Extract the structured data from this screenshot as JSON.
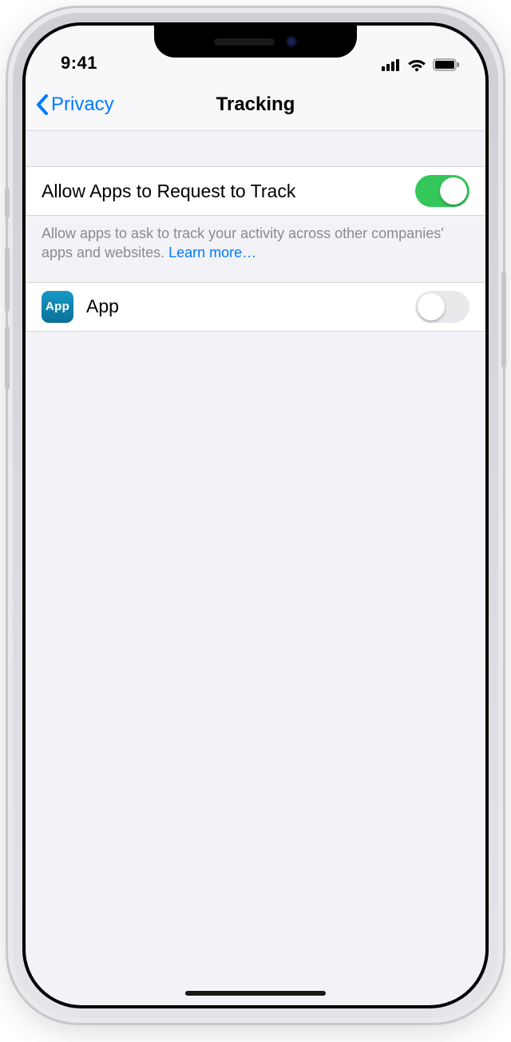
{
  "status": {
    "time": "9:41"
  },
  "nav": {
    "back_label": "Privacy",
    "title": "Tracking"
  },
  "tracking": {
    "allow_label": "Allow Apps to Request to Track",
    "allow_on": true,
    "footer_text": "Allow apps to ask to track your activity across other companies' apps and websites. ",
    "learn_more": "Learn more…"
  },
  "apps": [
    {
      "icon_text": "App",
      "name": "App",
      "tracking_on": false
    }
  ]
}
